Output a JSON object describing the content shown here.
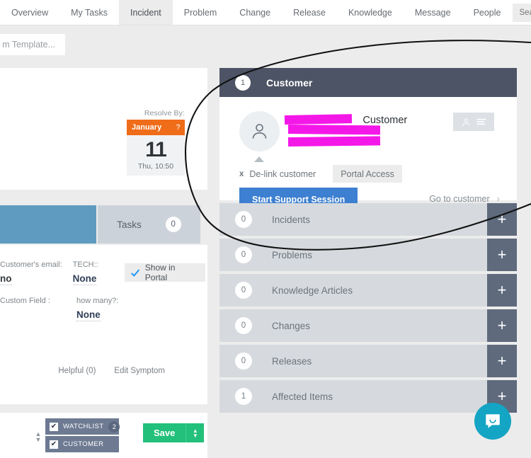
{
  "topnav": {
    "items": [
      {
        "label": "Overview",
        "active": false
      },
      {
        "label": "My Tasks",
        "active": false
      },
      {
        "label": "Incident",
        "active": true
      },
      {
        "label": "Problem",
        "active": false
      },
      {
        "label": "Change",
        "active": false
      },
      {
        "label": "Release",
        "active": false
      },
      {
        "label": "Knowledge",
        "active": false
      },
      {
        "label": "Message",
        "active": false
      },
      {
        "label": "People",
        "active": false
      }
    ],
    "search": {
      "placeholder": "Search...",
      "value": "",
      "icon": "search-icon"
    }
  },
  "subbar": {
    "template_field_text": "m Template..."
  },
  "left": {
    "resolve_by_label": "Resolve By:",
    "due_date": {
      "month": "January",
      "question_mark": "?",
      "day": "11",
      "time": "Thu, 10:50"
    },
    "tabs": {
      "tasks_label": "Tasks",
      "tasks_count": "0"
    },
    "fields": [
      {
        "label": "Customer's email:",
        "value": "no"
      },
      {
        "label": "TECH::",
        "value": "None"
      },
      {
        "label": "Custom Field :",
        "value": ""
      },
      {
        "label": "how many?:",
        "value": "None"
      }
    ],
    "show_in_portal": {
      "label": "Show in Portal",
      "checked": true
    },
    "links": [
      {
        "label": "Helpful (0)"
      },
      {
        "label": "Edit Symptom"
      }
    ]
  },
  "bottombar": {
    "checkboxes": [
      {
        "label": "WATCHLIST",
        "count": "2",
        "checked": true
      },
      {
        "label": "CUSTOMER",
        "count": "",
        "checked": true
      }
    ],
    "save_label": "Save"
  },
  "customer_panel": {
    "header": {
      "number": "1",
      "title": "Customer"
    },
    "name_suffix": "Customer",
    "avatar_icon": "person-icon",
    "contact_card_icon": "contact-card-icon",
    "delink_label": "De-link customer",
    "delink_x": "x",
    "portal_access_label": "Portal Access",
    "start_session_label": "Start Support Session",
    "go_to_customer_label": "Go to customer",
    "go_to_customer_chevron": "›"
  },
  "sections": [
    {
      "count": "0",
      "label": "Incidents",
      "add": "+"
    },
    {
      "count": "0",
      "label": "Problems",
      "add": "+"
    },
    {
      "count": "0",
      "label": "Knowledge Articles",
      "add": "+"
    },
    {
      "count": "0",
      "label": "Changes",
      "add": "+"
    },
    {
      "count": "0",
      "label": "Releases",
      "add": "+"
    },
    {
      "count": "1",
      "label": "Affected Items",
      "add": "+"
    }
  ],
  "chat": {
    "icon": "chat-bubble-icon"
  },
  "colors": {
    "nav_active_bg": "#ececec",
    "panel_header": "#4d5465",
    "section_bg": "#d6dade",
    "section_plus": "#5f6a7d",
    "primary_button": "#3d7fd0",
    "save_button": "#22c07a",
    "due_month": "#ef6c18",
    "tab_blue": "#5f9bc0",
    "checkbox_bar": "#6d7a92",
    "chat_bubble": "#14a5c4",
    "redaction": "#f418e8"
  }
}
